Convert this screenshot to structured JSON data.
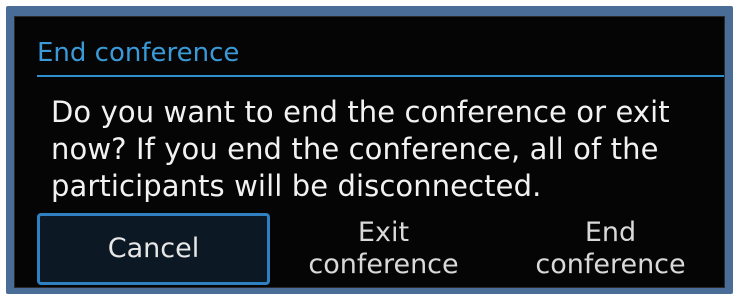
{
  "dialog": {
    "title": "End conference",
    "message_lines": [
      "Do you want to end the conference or exit",
      "now? If you end the conference, all of the",
      "participants will be disconnected."
    ],
    "buttons": [
      {
        "label": "Cancel"
      },
      {
        "label_lines": [
          "Exit",
          "conference"
        ]
      },
      {
        "label_lines": [
          "End",
          "conference"
        ]
      }
    ]
  },
  "colors": {
    "title": "#3a9ad8",
    "accent": "#2e8fcc",
    "background": "#050505",
    "outer_frame": "#4a6d97",
    "selected_button_border": "#2f7fc1"
  }
}
